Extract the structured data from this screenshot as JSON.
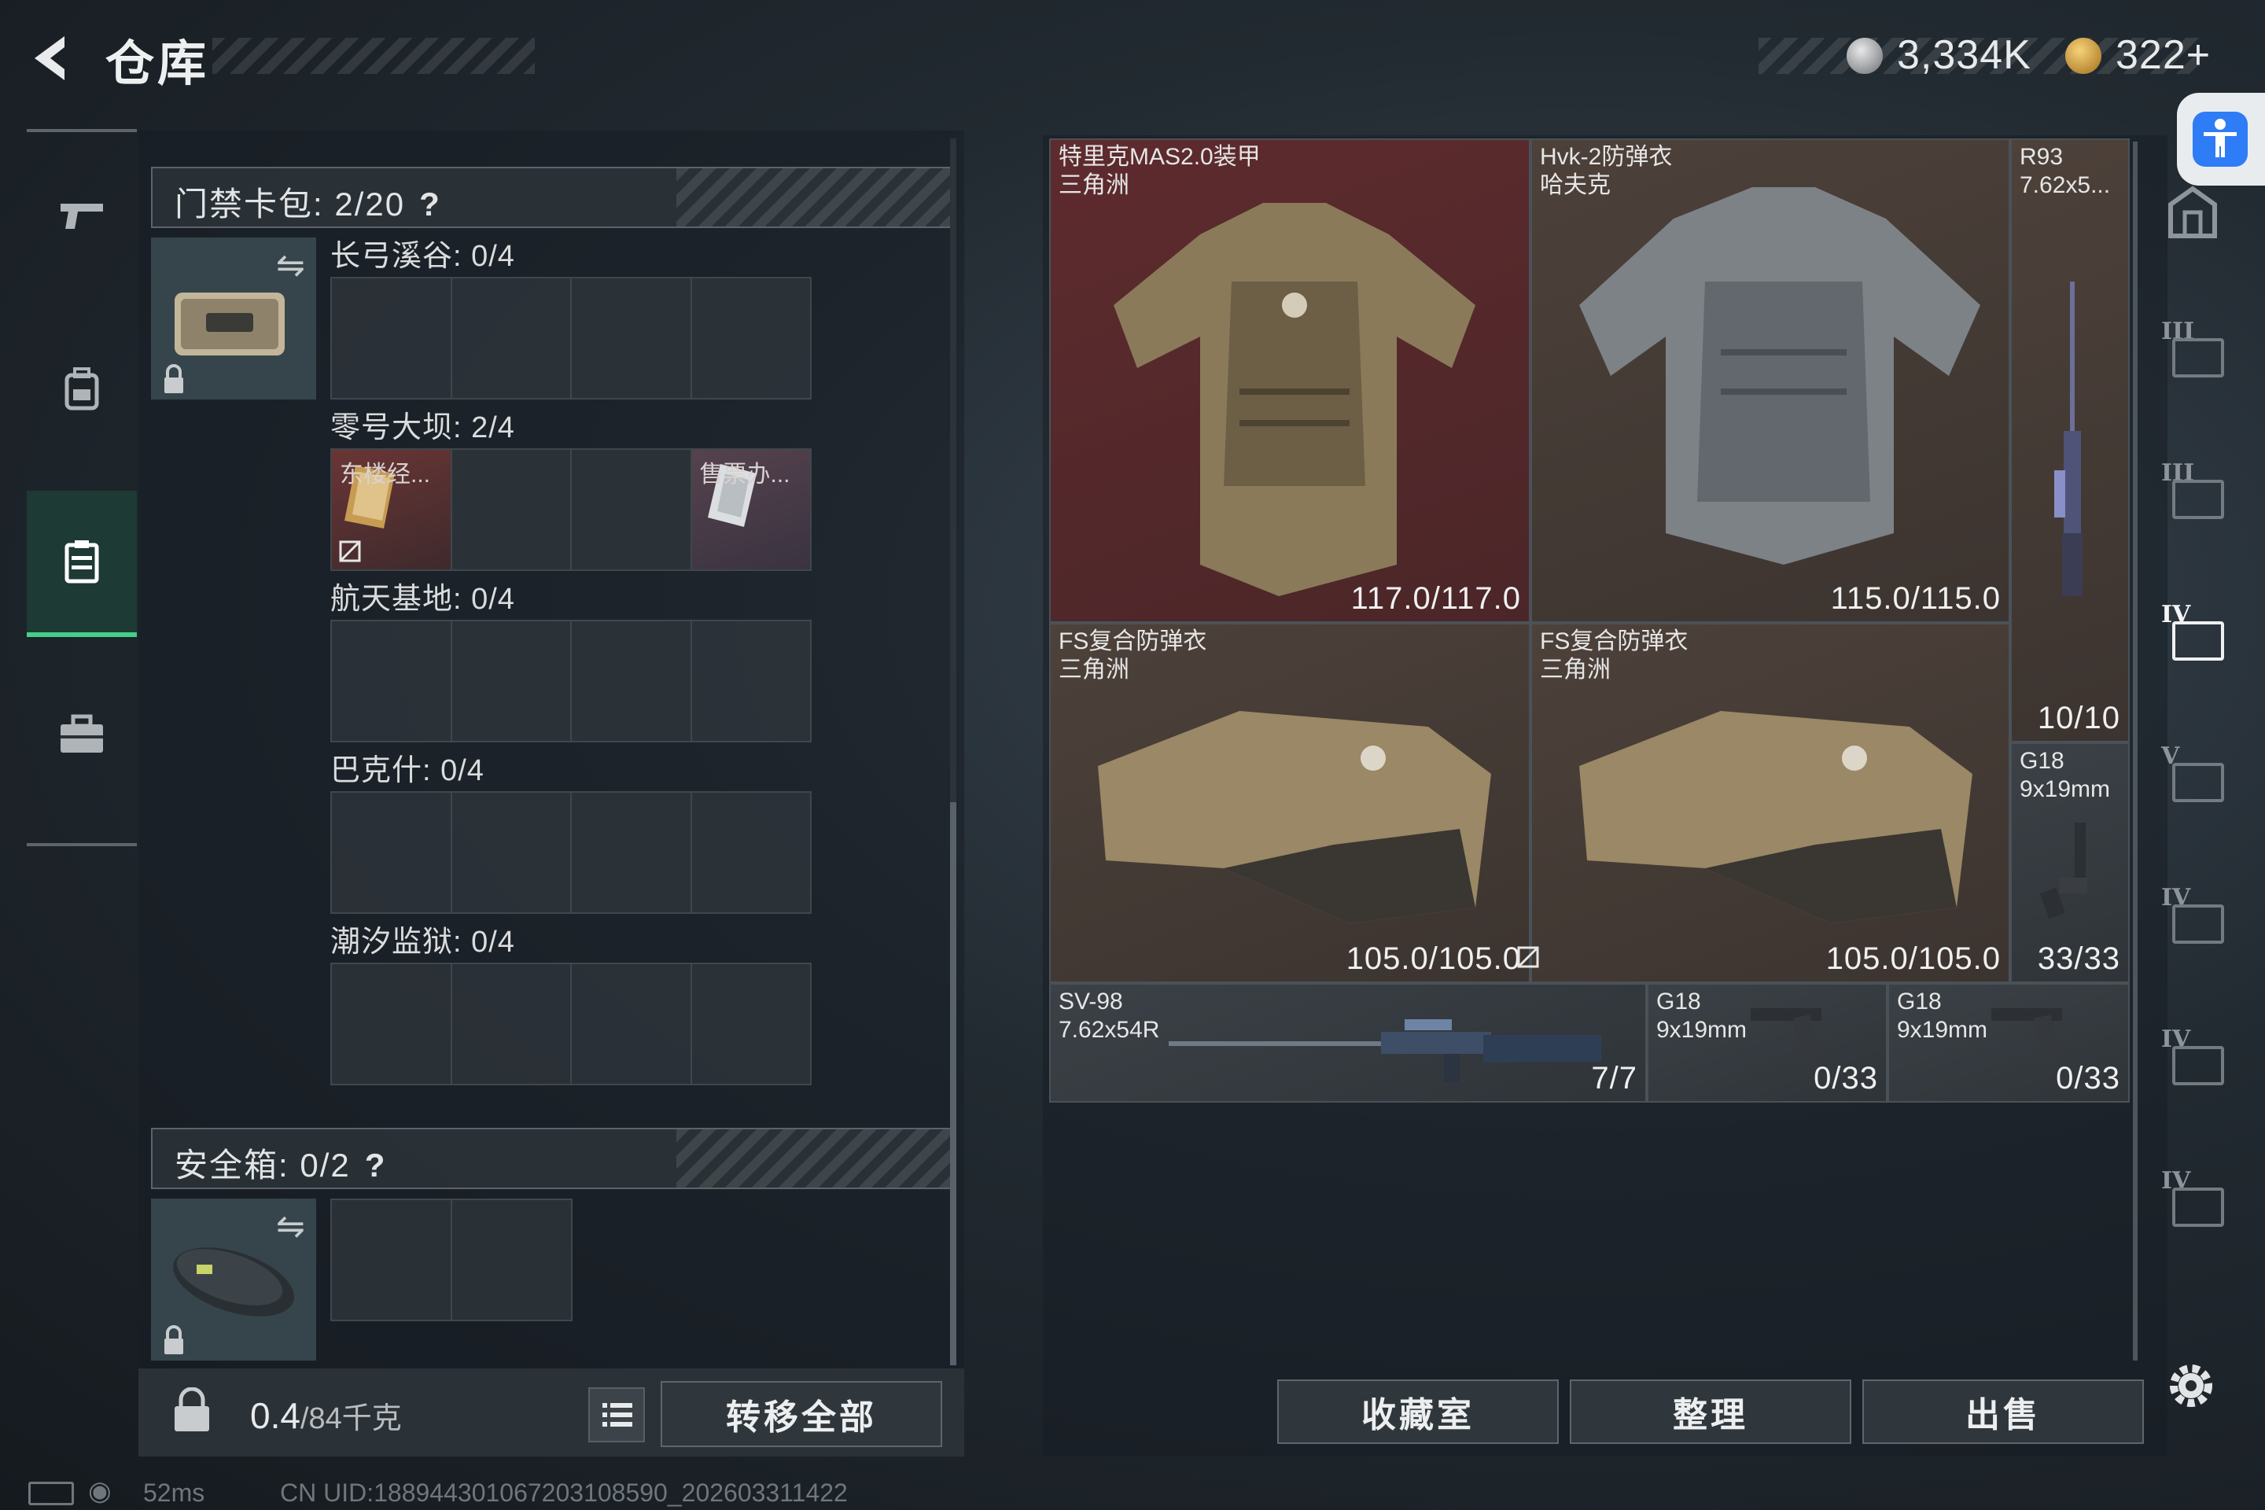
{
  "header": {
    "title": "仓库",
    "currency_silver": "3,334K",
    "currency_gold": "322+"
  },
  "containers": {
    "keycard_header": "门禁卡包: 2/20",
    "help_mark": "?",
    "keycard_groups": [
      {
        "label": "长弓溪谷: 0/4"
      },
      {
        "label": "零号大坝: 2/4",
        "slots": [
          "东楼经...",
          "售票办..."
        ]
      },
      {
        "label": "航天基地: 0/4"
      },
      {
        "label": "巴克什: 0/4"
      },
      {
        "label": "潮汐监狱: 0/4"
      }
    ],
    "safebox_header": "安全箱: 0/2"
  },
  "footer": {
    "weight_current": "0.4",
    "weight_max": "/84千克",
    "transfer_all": "转移全部"
  },
  "warehouse": {
    "items": [
      {
        "name": "特里克MAS2.0装甲",
        "sub": "三角洲",
        "value": "117.0/117.0",
        "rarity": "red"
      },
      {
        "name": "Hvk-2防弹衣",
        "sub": "哈夫克",
        "value": "115.0/115.0",
        "rarity": "brown"
      },
      {
        "name": "R93",
        "sub": "7.62x5...",
        "value": "10/10",
        "rarity": "brown"
      },
      {
        "name": "FS复合防弹衣",
        "sub": "三角洲",
        "value": "105.0/105.0",
        "rarity": "brown"
      },
      {
        "name": "FS复合防弹衣",
        "sub": "三角洲",
        "value": "105.0/105.0",
        "rarity": "brown"
      },
      {
        "name": "G18",
        "sub": "9x19mm",
        "value": "33/33",
        "rarity": "dark"
      },
      {
        "name": "SV-98",
        "sub": "7.62x54R",
        "value": "7/7",
        "rarity": "dark"
      },
      {
        "name": "G18",
        "sub": "9x19mm",
        "value": "0/33",
        "rarity": "dark"
      },
      {
        "name": "G18",
        "sub": "9x19mm",
        "value": "0/33",
        "rarity": "dark"
      }
    ],
    "buttons": {
      "collection": "收藏室",
      "organize": "整理",
      "sell": "出售"
    }
  },
  "level_nav": [
    "III",
    "III",
    "IV",
    "V",
    "IV",
    "IV",
    "IV"
  ],
  "status": {
    "ping": "52ms",
    "uid": "CN UID:188944301067203108590_202603311422"
  },
  "colors": {
    "accent_green": "#44d08a",
    "rarity_red": "#5e2b2e",
    "rarity_brown": "#4d413a",
    "access_blue": "#2e7cf6",
    "gold": "#d9a642"
  },
  "icons": [
    "back-arrow-icon",
    "silver-coin-icon",
    "gold-coin-icon",
    "accessibility-icon",
    "pistol-icon",
    "backpack-icon",
    "keycard-case-icon",
    "briefcase-icon",
    "swap-icon",
    "lock-icon",
    "list-icon",
    "settings-icon",
    "wifi-icon",
    "battery-icon",
    "no-insure-icon"
  ]
}
